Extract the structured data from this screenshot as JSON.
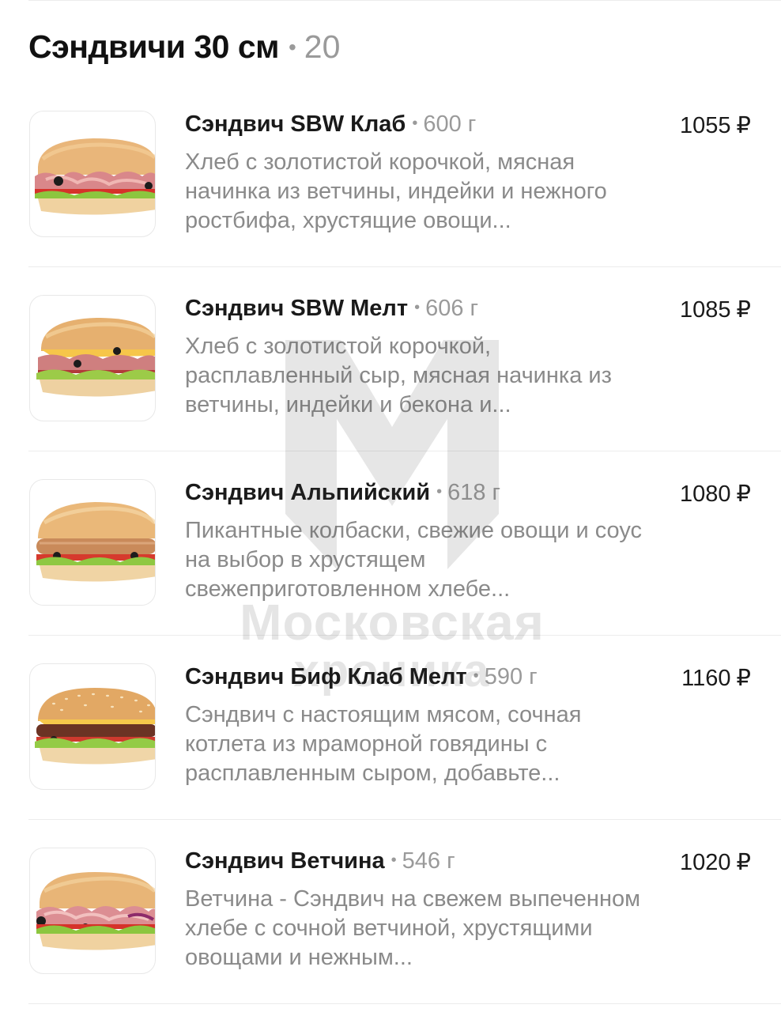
{
  "section": {
    "title": "Сэндвичи 30 см",
    "separator": "•",
    "count": "20"
  },
  "products": [
    {
      "name": "Сэндвич SBW Клаб",
      "weight": "600 г",
      "description": "Хлеб с золотистой корочкой, мясная начинка из ветчины, индейки и нежного ростбифа, хрустящие овощи...",
      "price": "1055",
      "currency": "₽",
      "image_icon": "sandwich-ham-image"
    },
    {
      "name": "Сэндвич SBW Мелт",
      "weight": "606 г",
      "description": "Хлеб с золотистой корочкой, расплавленный сыр, мясная начинка из ветчины, индейки и бекона и...",
      "price": "1085",
      "currency": "₽",
      "image_icon": "sandwich-melt-image"
    },
    {
      "name": "Сэндвич Альпийский",
      "weight": "618 г",
      "description": "Пикантные колбаски, свежие овощи и соус на выбор в хрустящем свежеприготовленном хлебе...",
      "price": "1080",
      "currency": "₽",
      "image_icon": "sandwich-sausage-image"
    },
    {
      "name": "Сэндвич Биф Клаб Мелт",
      "weight": "590 г",
      "description": "Сэндвич с настоящим мясом, сочная котлета из мраморной говядины с расплавленным сыром, добавьте...",
      "price": "1160",
      "currency": "₽",
      "image_icon": "sandwich-beef-image"
    },
    {
      "name": "Сэндвич Ветчина",
      "weight": "546 г",
      "description": "Ветчина - Сэндвич на свежем выпеченном хлебе с сочной ветчиной, хрустящими овощами и нежным...",
      "price": "1020",
      "currency": "₽",
      "image_icon": "sandwich-ham-image"
    }
  ],
  "watermark": {
    "line1": "Московская",
    "line2": "хроника"
  },
  "colors": {
    "title": "#111111",
    "muted": "#9a9a9a",
    "description": "#8a8a8a",
    "divider": "#ececec"
  }
}
